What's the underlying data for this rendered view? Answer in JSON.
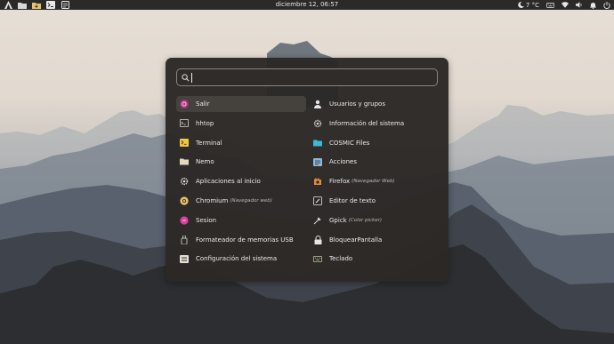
{
  "panel": {
    "clock": "diciembre 12, 06:57",
    "temperature": "7 °C"
  },
  "launcher": {
    "search_placeholder": "",
    "search_value": "",
    "left_items": [
      {
        "name": "Salir",
        "desc": "",
        "icon": "exit-icon",
        "color": "#c0398f",
        "selected": true
      },
      {
        "name": "hhtop",
        "desc": "",
        "icon": "terminal-icon",
        "color": "#d9d9d9"
      },
      {
        "name": "Terminal",
        "desc": "",
        "icon": "terminal-icon",
        "color": "#f5c542"
      },
      {
        "name": "Nemo",
        "desc": "",
        "icon": "folder-icon",
        "color": "#e3d9c0"
      },
      {
        "name": "Aplicaciones al inicio",
        "desc": "",
        "icon": "gear-icon",
        "color": "#d9d9d9"
      },
      {
        "name": "Chromium",
        "desc": "(Navegador web)",
        "icon": "chromium-icon",
        "color": "#e8c268"
      },
      {
        "name": "Sesion",
        "desc": "",
        "icon": "session-icon",
        "color": "#d93fa0"
      },
      {
        "name": "Formateador de memorias USB",
        "desc": "",
        "icon": "usb-icon",
        "color": "#d9d9d9"
      },
      {
        "name": "Configuración del sistema",
        "desc": "",
        "icon": "settings-icon",
        "color": "#e5e0d6"
      }
    ],
    "right_items": [
      {
        "name": "Usuarios y grupos",
        "desc": "",
        "icon": "user-icon",
        "color": "#e5e5e5"
      },
      {
        "name": "Información del sistema",
        "desc": "",
        "icon": "gear-icon",
        "color": "#d9d9d9"
      },
      {
        "name": "COSMIC Files",
        "desc": "",
        "icon": "folder-icon",
        "color": "#3fb8d8"
      },
      {
        "name": "Acciones",
        "desc": "",
        "icon": "actions-icon",
        "color": "#8fb8d8"
      },
      {
        "name": "Firefox",
        "desc": "(Navegador Web)",
        "icon": "firefox-icon",
        "color": "#e08a3c"
      },
      {
        "name": "Editor de texto",
        "desc": "",
        "icon": "text-editor-icon",
        "color": "#e5e5e5"
      },
      {
        "name": "Gpick",
        "desc": "(Color picker)",
        "icon": "color-picker-icon",
        "color": "#d9d9d9"
      },
      {
        "name": "BloquearPantalla",
        "desc": "",
        "icon": "lock-icon",
        "color": "#e5e5e5"
      },
      {
        "name": "Teclado",
        "desc": "",
        "icon": "keyboard-icon",
        "color": "#b8c49a"
      }
    ]
  }
}
